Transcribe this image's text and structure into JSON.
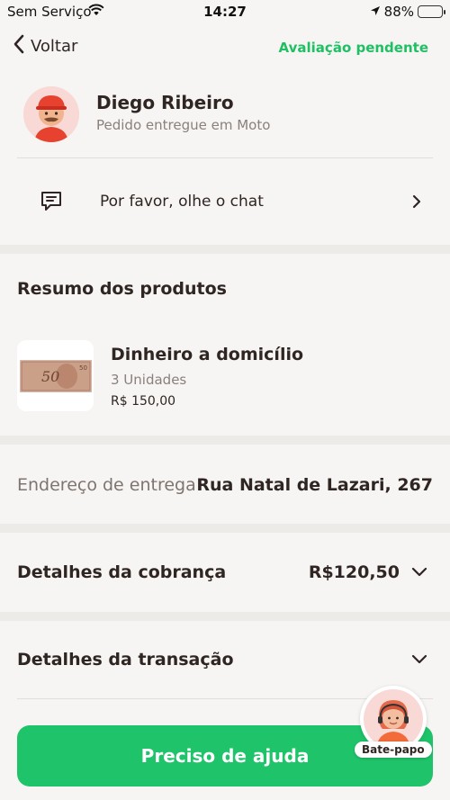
{
  "status_bar": {
    "carrier": "Sem Serviço",
    "time": "14:27",
    "battery": "88%",
    "battery_level": 0.88
  },
  "nav": {
    "back_label": "Voltar",
    "status_label": "Avaliação pendente"
  },
  "courier": {
    "name": "Diego Ribeiro",
    "subtitle": "Pedido entregue em Moto"
  },
  "chat_prompt": {
    "label": "Por favor, olhe o chat"
  },
  "summary": {
    "title": "Resumo dos produtos",
    "product": {
      "name": "Dinheiro a domicílio",
      "quantity": "3 Unidades",
      "price": "R$ 150,00",
      "note_value": "50"
    }
  },
  "address": {
    "label": "Endereço de entrega",
    "value": "Rua Natal de Lazari, 267"
  },
  "billing": {
    "label": "Detalhes da cobrança",
    "value": "R$120,50"
  },
  "transaction": {
    "label": "Detalhes da transação"
  },
  "help": {
    "button_label": "Preciso de ajuda"
  },
  "support_chat": {
    "label": "Bate-papo"
  },
  "colors": {
    "accent_green": "#1fc46a",
    "pending_green": "#1fbf63",
    "text_dark": "#2f2522",
    "text_muted": "#8a807c",
    "background": "#f6f5f3"
  }
}
